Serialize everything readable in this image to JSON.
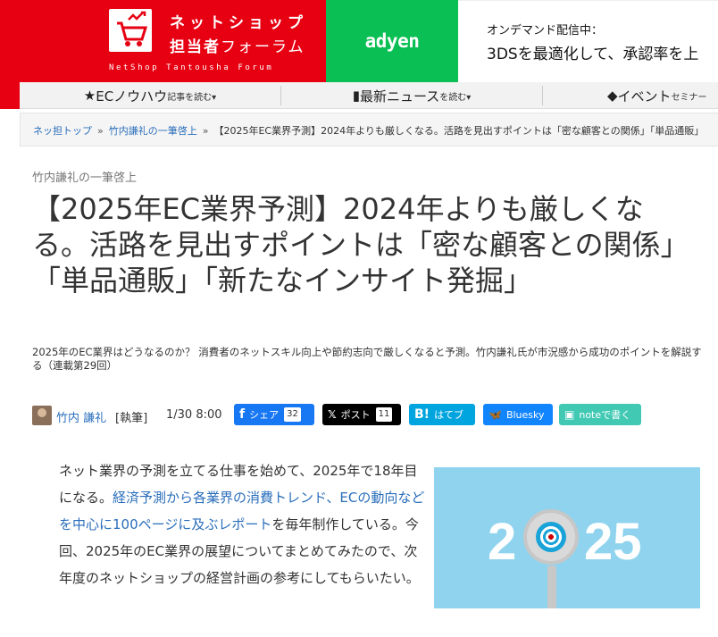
{
  "header": {
    "logo_title_1": "ネットショップ",
    "logo_title_2a": "担当者",
    "logo_title_2b": "フォーラム",
    "logo_subtitle": "NetShop Tantousha Forum"
  },
  "ad": {
    "brand": "adyen",
    "line1": "オンデマンド配信中：",
    "line2": "3DSを最適化して、承認率を上"
  },
  "nav": {
    "items": [
      {
        "icon": "★",
        "label": "ECノウハウ",
        "small": "記事を読む▾"
      },
      {
        "icon": "▮",
        "label": "最新ニュース",
        "small": "を読む▾"
      },
      {
        "icon": "◆",
        "label": "イベント",
        "small": "セミナー"
      }
    ]
  },
  "breadcrumb": {
    "home": "ネッ担トップ",
    "category": "竹内謙礼の一筆啓上",
    "current": "【2025年EC業界予測】2024年よりも厳しくなる。活路を見出すポイントは「密な顧客との関係」「単品通販」",
    "separator": "»"
  },
  "article": {
    "category": "竹内謙礼の一筆啓上",
    "title": "【2025年EC業界予測】2024年よりも厳しくなる。活路を見出すポイントは「密な顧客との関係」「単品通販」「新たなインサイト発掘」",
    "lead": "2025年のEC業界はどうなるのか？ 消費者のネットスキル向上や節約志向で厳しくなると予測。竹内謙礼氏が市況感から成功のポイントを解説する（連載第29回）",
    "author": "竹内 謙礼",
    "role": "[執筆]",
    "date": "1/30 8:00",
    "body_1": "ネット業界の予測を立てる仕事を始めて、2025年で18年目になる。",
    "body_link": "経済予測から各業界の消費トレンド、ECの動向などを中心に100ページに及ぶレポート",
    "body_2": "を毎年制作している。今回、2025年のEC業界の展望についてまとめてみたので、次年度のネットショップの経営計画の参考にしてもらいたい。",
    "hero_text_left": "2",
    "hero_text_right": "25"
  },
  "share": {
    "facebook": {
      "label": "シェア",
      "count": "32",
      "icon": "f"
    },
    "x": {
      "label": "ポスト",
      "count": "11",
      "icon": "𝕏"
    },
    "hatena": {
      "label": "はてブ",
      "icon": "B!"
    },
    "bluesky": {
      "label": "Bluesky",
      "icon": "🦋"
    },
    "note": {
      "label": "noteで書く",
      "icon": "▣"
    }
  },
  "colors": {
    "brand_red": "#e60012",
    "adyen_green": "#0abf53",
    "link_blue": "#2a6ebb",
    "facebook": "#1877f2",
    "x": "#000000",
    "hatena": "#00a4de",
    "bluesky": "#1185fe",
    "note": "#41c9b4"
  }
}
